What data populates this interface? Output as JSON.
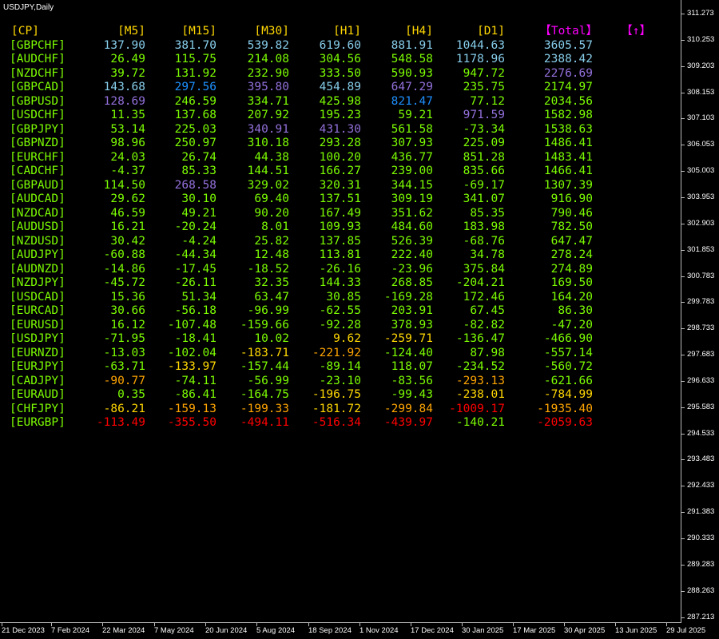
{
  "chart": {
    "title": "USDJPY,Daily"
  },
  "price_axis": [
    "311.273",
    "310.253",
    "309.203",
    "308.153",
    "307.103",
    "306.053",
    "305.003",
    "303.953",
    "302.903",
    "301.853",
    "300.783",
    "299.783",
    "298.733",
    "297.683",
    "296.633",
    "295.583",
    "294.533",
    "293.483",
    "292.433",
    "291.383",
    "290.333",
    "289.283",
    "288.263",
    "287.213"
  ],
  "time_axis": [
    "21 Dec 2023",
    "7 Feb 2024",
    "22 Mar 2024",
    "7 May 2024",
    "20 Jun 2024",
    "5 Aug 2024",
    "18 Sep 2024",
    "1 Nov 2024",
    "17 Dec 2024",
    "30 Jan 2025",
    "17 Mar 2025",
    "30 Apr 2025",
    "13 Jun 2025",
    "29 Jul 2025"
  ],
  "headers": {
    "cp": "[CP]",
    "m5": "[M5]",
    "m15": "[M15]",
    "m30": "[M30]",
    "h1": "[H1]",
    "h4": "[H4]",
    "d1": "[D1]",
    "total": "【Total】",
    "arrow": "【↑】"
  },
  "colors": {
    "header": "#ffd700",
    "total_header": "#ff00ff",
    "pair": "#7cfc00",
    "axis_text": "#ffffff",
    "blue": "#1e90ff",
    "skyblue": "#87ceeb",
    "slateblue": "#9370db",
    "green": "#7cfc00",
    "gold": "#ffd700",
    "orange": "#ffa500",
    "red": "#ff0000"
  },
  "rows": [
    {
      "pair": "[GBPCHF]",
      "m5": "137.90",
      "m15": "381.70",
      "m30": "539.82",
      "h1": "619.60",
      "h4": "881.91",
      "d1": "1044.63",
      "total": "3605.57"
    },
    {
      "pair": "[AUDCHF]",
      "m5": "26.49",
      "m15": "115.75",
      "m30": "214.08",
      "h1": "304.56",
      "h4": "548.58",
      "d1": "1178.96",
      "total": "2388.42"
    },
    {
      "pair": "[NZDCHF]",
      "m5": "39.72",
      "m15": "131.92",
      "m30": "232.90",
      "h1": "333.50",
      "h4": "590.93",
      "d1": "947.72",
      "total": "2276.69"
    },
    {
      "pair": "[GBPCAD]",
      "m5": "143.68",
      "m15": "297.56",
      "m30": "395.80",
      "h1": "454.89",
      "h4": "647.29",
      "d1": "235.75",
      "total": "2174.97"
    },
    {
      "pair": "[GBPUSD]",
      "m5": "128.69",
      "m15": "246.59",
      "m30": "334.71",
      "h1": "425.98",
      "h4": "821.47",
      "d1": "77.12",
      "total": "2034.56"
    },
    {
      "pair": "[USDCHF]",
      "m5": "11.35",
      "m15": "137.68",
      "m30": "207.92",
      "h1": "195.23",
      "h4": "59.21",
      "d1": "971.59",
      "total": "1582.98"
    },
    {
      "pair": "[GBPJPY]",
      "m5": "53.14",
      "m15": "225.03",
      "m30": "340.91",
      "h1": "431.30",
      "h4": "561.58",
      "d1": "-73.34",
      "total": "1538.63"
    },
    {
      "pair": "[GBPNZD]",
      "m5": "98.96",
      "m15": "250.97",
      "m30": "310.18",
      "h1": "293.28",
      "h4": "307.93",
      "d1": "225.09",
      "total": "1486.41"
    },
    {
      "pair": "[EURCHF]",
      "m5": "24.03",
      "m15": "26.74",
      "m30": "44.38",
      "h1": "100.20",
      "h4": "436.77",
      "d1": "851.28",
      "total": "1483.41"
    },
    {
      "pair": "[CADCHF]",
      "m5": "-4.37",
      "m15": "85.33",
      "m30": "144.51",
      "h1": "166.27",
      "h4": "239.00",
      "d1": "835.66",
      "total": "1466.41"
    },
    {
      "pair": "[GBPAUD]",
      "m5": "114.50",
      "m15": "268.58",
      "m30": "329.02",
      "h1": "320.31",
      "h4": "344.15",
      "d1": "-69.17",
      "total": "1307.39"
    },
    {
      "pair": "[AUDCAD]",
      "m5": "29.62",
      "m15": "30.10",
      "m30": "69.40",
      "h1": "137.51",
      "h4": "309.19",
      "d1": "341.07",
      "total": "916.90"
    },
    {
      "pair": "[NZDCAD]",
      "m5": "46.59",
      "m15": "49.21",
      "m30": "90.20",
      "h1": "167.49",
      "h4": "351.62",
      "d1": "85.35",
      "total": "790.46"
    },
    {
      "pair": "[AUDUSD]",
      "m5": "16.21",
      "m15": "-20.24",
      "m30": "8.01",
      "h1": "109.93",
      "h4": "484.60",
      "d1": "183.98",
      "total": "782.50"
    },
    {
      "pair": "[NZDUSD]",
      "m5": "30.42",
      "m15": "-4.24",
      "m30": "25.82",
      "h1": "137.85",
      "h4": "526.39",
      "d1": "-68.76",
      "total": "647.47"
    },
    {
      "pair": "[AUDJPY]",
      "m5": "-60.88",
      "m15": "-44.34",
      "m30": "12.48",
      "h1": "113.81",
      "h4": "222.40",
      "d1": "34.78",
      "total": "278.24"
    },
    {
      "pair": "[AUDNZD]",
      "m5": "-14.86",
      "m15": "-17.45",
      "m30": "-18.52",
      "h1": "-26.16",
      "h4": "-23.96",
      "d1": "375.84",
      "total": "274.89"
    },
    {
      "pair": "[NZDJPY]",
      "m5": "-45.72",
      "m15": "-26.11",
      "m30": "32.35",
      "h1": "144.33",
      "h4": "268.85",
      "d1": "-204.21",
      "total": "169.50"
    },
    {
      "pair": "[USDCAD]",
      "m5": "15.36",
      "m15": "51.34",
      "m30": "63.47",
      "h1": "30.85",
      "h4": "-169.28",
      "d1": "172.46",
      "total": "164.20"
    },
    {
      "pair": "[EURCAD]",
      "m5": "30.66",
      "m15": "-56.18",
      "m30": "-96.99",
      "h1": "-62.55",
      "h4": "203.91",
      "d1": "67.45",
      "total": "86.30"
    },
    {
      "pair": "[EURUSD]",
      "m5": "16.12",
      "m15": "-107.48",
      "m30": "-159.66",
      "h1": "-92.28",
      "h4": "378.93",
      "d1": "-82.82",
      "total": "-47.20"
    },
    {
      "pair": "[USDJPY]",
      "m5": "-71.95",
      "m15": "-18.41",
      "m30": "10.02",
      "h1": "9.62",
      "h4": "-259.71",
      "d1": "-136.47",
      "total": "-466.90"
    },
    {
      "pair": "[EURNZD]",
      "m5": "-13.03",
      "m15": "-102.04",
      "m30": "-183.71",
      "h1": "-221.92",
      "h4": "-124.40",
      "d1": "87.98",
      "total": "-557.14"
    },
    {
      "pair": "[EURJPY]",
      "m5": "-63.71",
      "m15": "-133.97",
      "m30": "-157.44",
      "h1": "-89.14",
      "h4": "118.07",
      "d1": "-234.52",
      "total": "-560.72"
    },
    {
      "pair": "[CADJPY]",
      "m5": "-90.77",
      "m15": "-74.11",
      "m30": "-56.99",
      "h1": "-23.10",
      "h4": "-83.56",
      "d1": "-293.13",
      "total": "-621.66"
    },
    {
      "pair": "[EURAUD]",
      "m5": "0.35",
      "m15": "-86.41",
      "m30": "-164.75",
      "h1": "-196.75",
      "h4": "-99.43",
      "d1": "-238.01",
      "total": "-784.99"
    },
    {
      "pair": "[CHFJPY]",
      "m5": "-86.21",
      "m15": "-159.13",
      "m30": "-199.33",
      "h1": "-181.72",
      "h4": "-299.84",
      "d1": "-1009.17",
      "total": "-1935.40"
    },
    {
      "pair": "[EURGBP]",
      "m5": "-113.49",
      "m15": "-355.50",
      "m30": "-494.11",
      "h1": "-516.34",
      "h4": "-439.97",
      "d1": "-140.21",
      "total": "-2059.63"
    }
  ]
}
